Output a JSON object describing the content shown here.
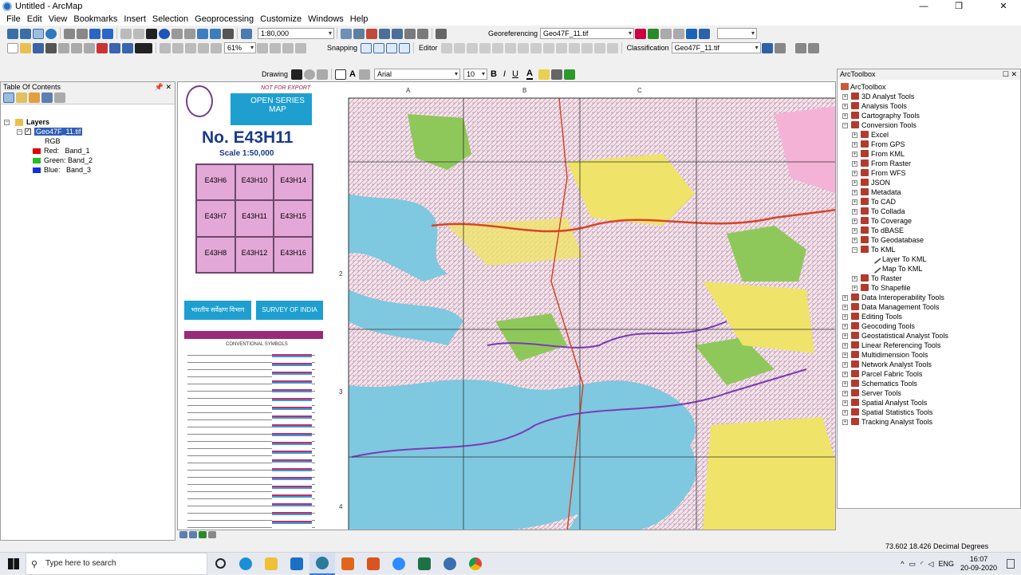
{
  "window": {
    "title": "Untitled - ArcMap"
  },
  "menu": [
    "File",
    "Edit",
    "View",
    "Bookmarks",
    "Insert",
    "Selection",
    "Geoprocessing",
    "Customize",
    "Windows",
    "Help"
  ],
  "toolbar": {
    "scale": "1:80,000",
    "georef_label": "Georeferencing",
    "georef_layer": "Geo47F_11.tif",
    "zoom_pct": "61%",
    "snapping_label": "Snapping",
    "editor_label": "Editor",
    "classification_label": "Classification",
    "classification_layer": "Geo47F_11.tif",
    "drawing_label": "Drawing",
    "font_name": "Arial",
    "font_size": "10",
    "bold": "B",
    "italic": "I",
    "underline": "U"
  },
  "toc": {
    "title": "Table Of Contents",
    "root": "Layers",
    "layer": "Geo47F_11.tif",
    "rgb": "RGB",
    "bands": [
      {
        "label": "Red:",
        "band": "Band_1",
        "color": "#e00000"
      },
      {
        "label": "Green:",
        "band": "Band_2",
        "color": "#20c020"
      },
      {
        "label": "Blue:",
        "band": "Band_3",
        "color": "#1030e0"
      }
    ]
  },
  "legend": {
    "series": "OPEN SERIES MAP",
    "sheet_no": "No.  E43H11",
    "scale": "Scale   1:50,000",
    "index": [
      [
        "E43H6",
        "E43H10",
        "E43H14"
      ],
      [
        "E43H7",
        "E43H11",
        "E43H15"
      ],
      [
        "E43H8",
        "E43H12",
        "E43H16"
      ]
    ],
    "survey_hindi": "भारतीय सर्वेक्षण विभाग",
    "survey_en": "SURVEY OF INDIA",
    "conventional": "CONVENTIONAL SYMBOLS",
    "top_note": "NOT FOR EXPORT"
  },
  "map": {
    "col_labels": [
      "A",
      "B",
      "C"
    ],
    "row_labels": [
      "2",
      "3",
      "4"
    ]
  },
  "toolbox": {
    "title": "ArcToolbox",
    "root": "ArcToolbox",
    "items": [
      {
        "label": "3D Analyst Tools",
        "level": 0,
        "expand": "+"
      },
      {
        "label": "Analysis Tools",
        "level": 0,
        "expand": "+"
      },
      {
        "label": "Cartography Tools",
        "level": 0,
        "expand": "+"
      },
      {
        "label": "Conversion Tools",
        "level": 0,
        "expand": "−"
      },
      {
        "label": "Excel",
        "level": 1,
        "expand": "+"
      },
      {
        "label": "From GPS",
        "level": 1,
        "expand": "+"
      },
      {
        "label": "From KML",
        "level": 1,
        "expand": "+"
      },
      {
        "label": "From Raster",
        "level": 1,
        "expand": "+"
      },
      {
        "label": "From WFS",
        "level": 1,
        "expand": "+"
      },
      {
        "label": "JSON",
        "level": 1,
        "expand": "+"
      },
      {
        "label": "Metadata",
        "level": 1,
        "expand": "+"
      },
      {
        "label": "To CAD",
        "level": 1,
        "expand": "+"
      },
      {
        "label": "To Collada",
        "level": 1,
        "expand": "+"
      },
      {
        "label": "To Coverage",
        "level": 1,
        "expand": "+"
      },
      {
        "label": "To dBASE",
        "level": 1,
        "expand": "+"
      },
      {
        "label": "To Geodatabase",
        "level": 1,
        "expand": "+"
      },
      {
        "label": "To KML",
        "level": 1,
        "expand": "−"
      },
      {
        "label": "Layer To KML",
        "level": 2,
        "expand": ""
      },
      {
        "label": "Map To KML",
        "level": 2,
        "expand": ""
      },
      {
        "label": "To Raster",
        "level": 1,
        "expand": "+"
      },
      {
        "label": "To Shapefile",
        "level": 1,
        "expand": "+"
      },
      {
        "label": "Data Interoperability Tools",
        "level": 0,
        "expand": "+"
      },
      {
        "label": "Data Management Tools",
        "level": 0,
        "expand": "+"
      },
      {
        "label": "Editing Tools",
        "level": 0,
        "expand": "+"
      },
      {
        "label": "Geocoding Tools",
        "level": 0,
        "expand": "+"
      },
      {
        "label": "Geostatistical Analyst Tools",
        "level": 0,
        "expand": "+"
      },
      {
        "label": "Linear Referencing Tools",
        "level": 0,
        "expand": "+"
      },
      {
        "label": "Multidimension Tools",
        "level": 0,
        "expand": "+"
      },
      {
        "label": "Network Analyst Tools",
        "level": 0,
        "expand": "+"
      },
      {
        "label": "Parcel Fabric Tools",
        "level": 0,
        "expand": "+"
      },
      {
        "label": "Schematics Tools",
        "level": 0,
        "expand": "+"
      },
      {
        "label": "Server Tools",
        "level": 0,
        "expand": "+"
      },
      {
        "label": "Spatial Analyst Tools",
        "level": 0,
        "expand": "+"
      },
      {
        "label": "Spatial Statistics Tools",
        "level": 0,
        "expand": "+"
      },
      {
        "label": "Tracking Analyst Tools",
        "level": 0,
        "expand": "+"
      }
    ]
  },
  "status": {
    "coords": "73.602  18.426 Decimal Degrees"
  },
  "taskbar": {
    "search_placeholder": "Type here to search",
    "lang": "ENG",
    "time": "16:07",
    "date": "20-09-2020",
    "apps": [
      {
        "name": "task-view-icon",
        "color": "#222"
      },
      {
        "name": "edge-icon",
        "color": "#1b8fd6"
      },
      {
        "name": "file-explorer-icon",
        "color": "#f2c037"
      },
      {
        "name": "mail-icon",
        "color": "#1b6fc4"
      },
      {
        "name": "arcmap-icon",
        "color": "#2a7a9c"
      },
      {
        "name": "matlab-icon",
        "color": "#e2661a"
      },
      {
        "name": "matlab2-icon",
        "color": "#d9541e"
      },
      {
        "name": "zoom-icon",
        "color": "#2d8cff"
      },
      {
        "name": "excel-icon",
        "color": "#1e7145"
      },
      {
        "name": "network-icon",
        "color": "#3b6fb0"
      },
      {
        "name": "chrome-icon",
        "color": "#db4437"
      }
    ]
  }
}
